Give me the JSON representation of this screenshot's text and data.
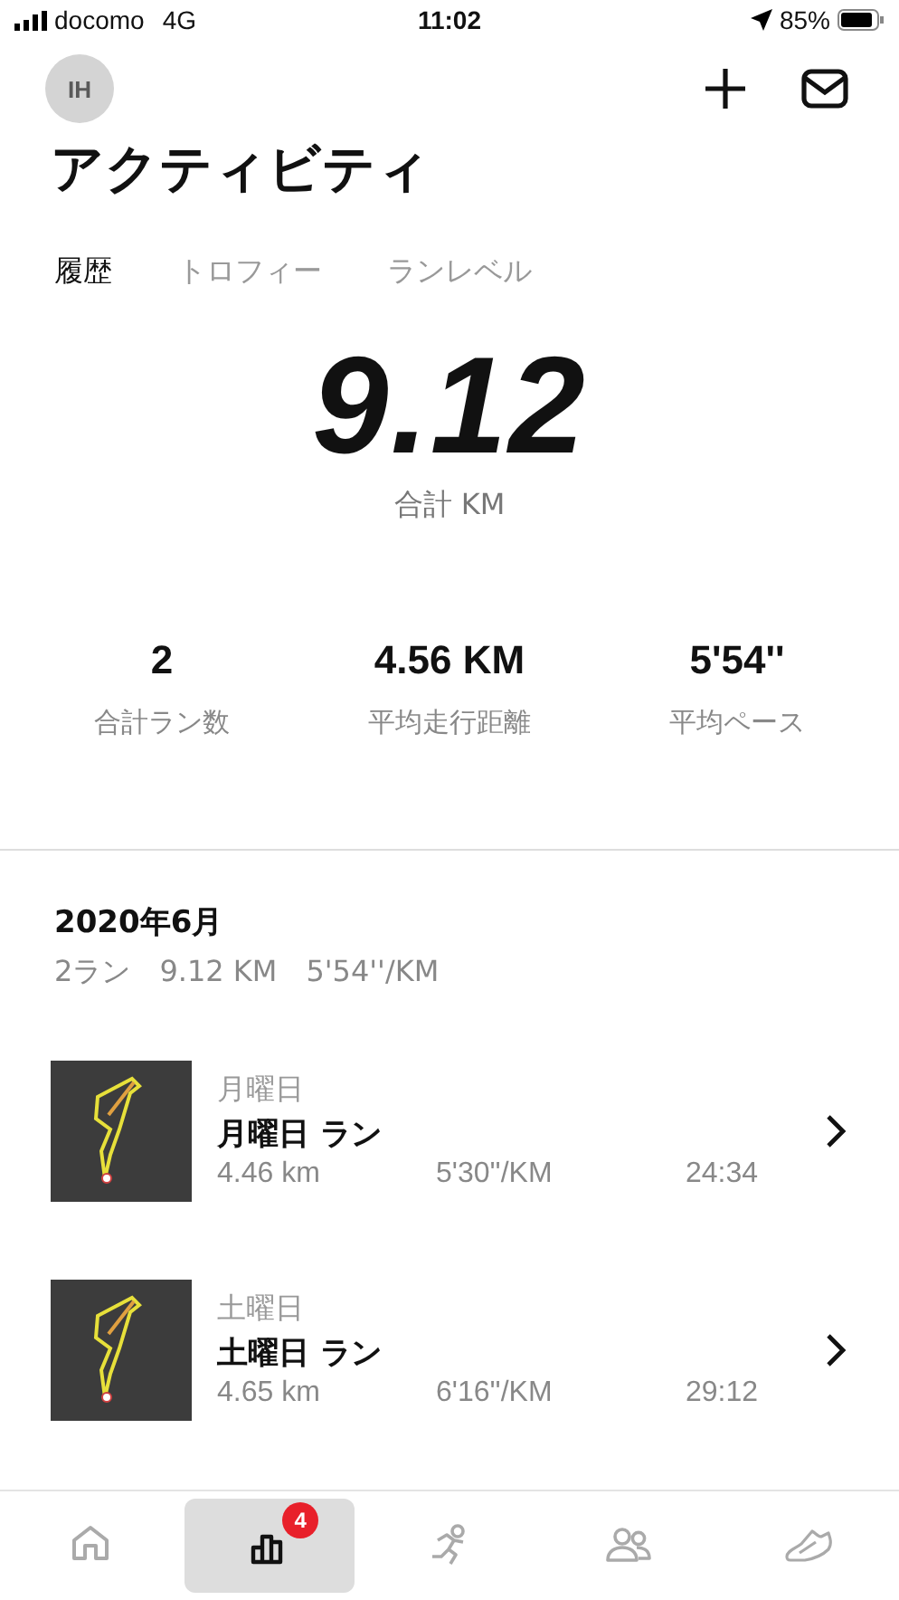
{
  "status_bar": {
    "carrier": "docomo",
    "network": "4G",
    "time": "11:02",
    "battery": "85%"
  },
  "header": {
    "avatar": "IH",
    "title": "アクティビティ"
  },
  "tabs": [
    {
      "label": "履歴",
      "selected": true
    },
    {
      "label": "トロフィー",
      "selected": false
    },
    {
      "label": "ランレベル",
      "selected": false
    }
  ],
  "total": {
    "value": "9.12",
    "label": "合計 KM"
  },
  "stats": [
    {
      "value": "2",
      "label": "合計ラン数"
    },
    {
      "value": "4.56 KM",
      "label": "平均走行距離"
    },
    {
      "value": "5'54''",
      "label": "平均ペース"
    }
  ],
  "month": {
    "title": "2020年6月",
    "summary": [
      "2ラン",
      "9.12 KM",
      "5'54''/KM"
    ]
  },
  "runs": [
    {
      "day": "月曜日",
      "title": "月曜日 ラン",
      "distance": "4.46 km",
      "pace": "5'30''/KM",
      "time": "24:34"
    },
    {
      "day": "土曜日",
      "title": "土曜日 ラン",
      "distance": "4.65 km",
      "pace": "6'16''/KM",
      "time": "29:12"
    }
  ],
  "nav": [
    {
      "selected": false
    },
    {
      "selected": true,
      "badge": "4"
    },
    {
      "selected": false
    },
    {
      "selected": false
    },
    {
      "selected": false
    }
  ]
}
